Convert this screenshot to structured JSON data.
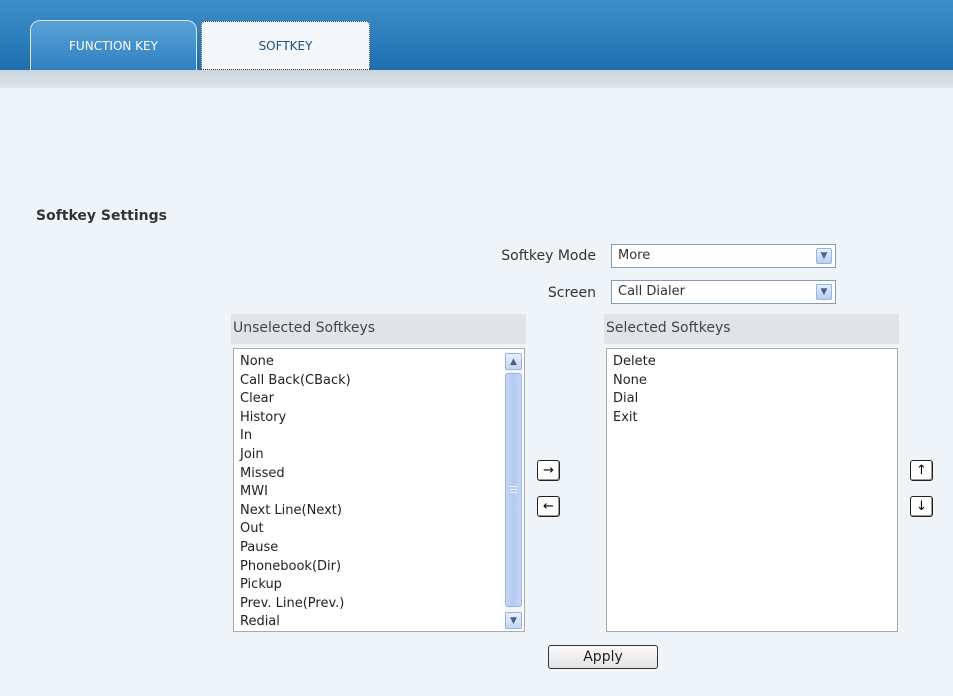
{
  "tabs": [
    {
      "label": "FUNCTION KEY"
    },
    {
      "label": "SOFTKEY"
    }
  ],
  "section_title": "Softkey Settings",
  "softkey_mode": {
    "label": "Softkey Mode",
    "value": "More"
  },
  "screen": {
    "label": "Screen",
    "value": "Call Dialer"
  },
  "unselected": {
    "header": "Unselected Softkeys",
    "items": [
      "None",
      "Call Back(CBack)",
      "Clear",
      "History",
      "In",
      "Join",
      "Missed",
      "MWI",
      "Next Line(Next)",
      "Out",
      "Pause",
      "Phonebook(Dir)",
      "Pickup",
      "Prev. Line(Prev.)",
      "Redial"
    ]
  },
  "selected": {
    "header": "Selected Softkeys",
    "items": [
      "Delete",
      "None",
      "Dial",
      "Exit"
    ]
  },
  "buttons": {
    "add": "→",
    "remove": "←",
    "up": "↑",
    "down": "↓",
    "apply": "Apply"
  },
  "icons": {
    "dropdown": "chevron-down-icon",
    "scroll_up": "chevron-up-icon",
    "scroll_down": "chevron-down-icon"
  }
}
